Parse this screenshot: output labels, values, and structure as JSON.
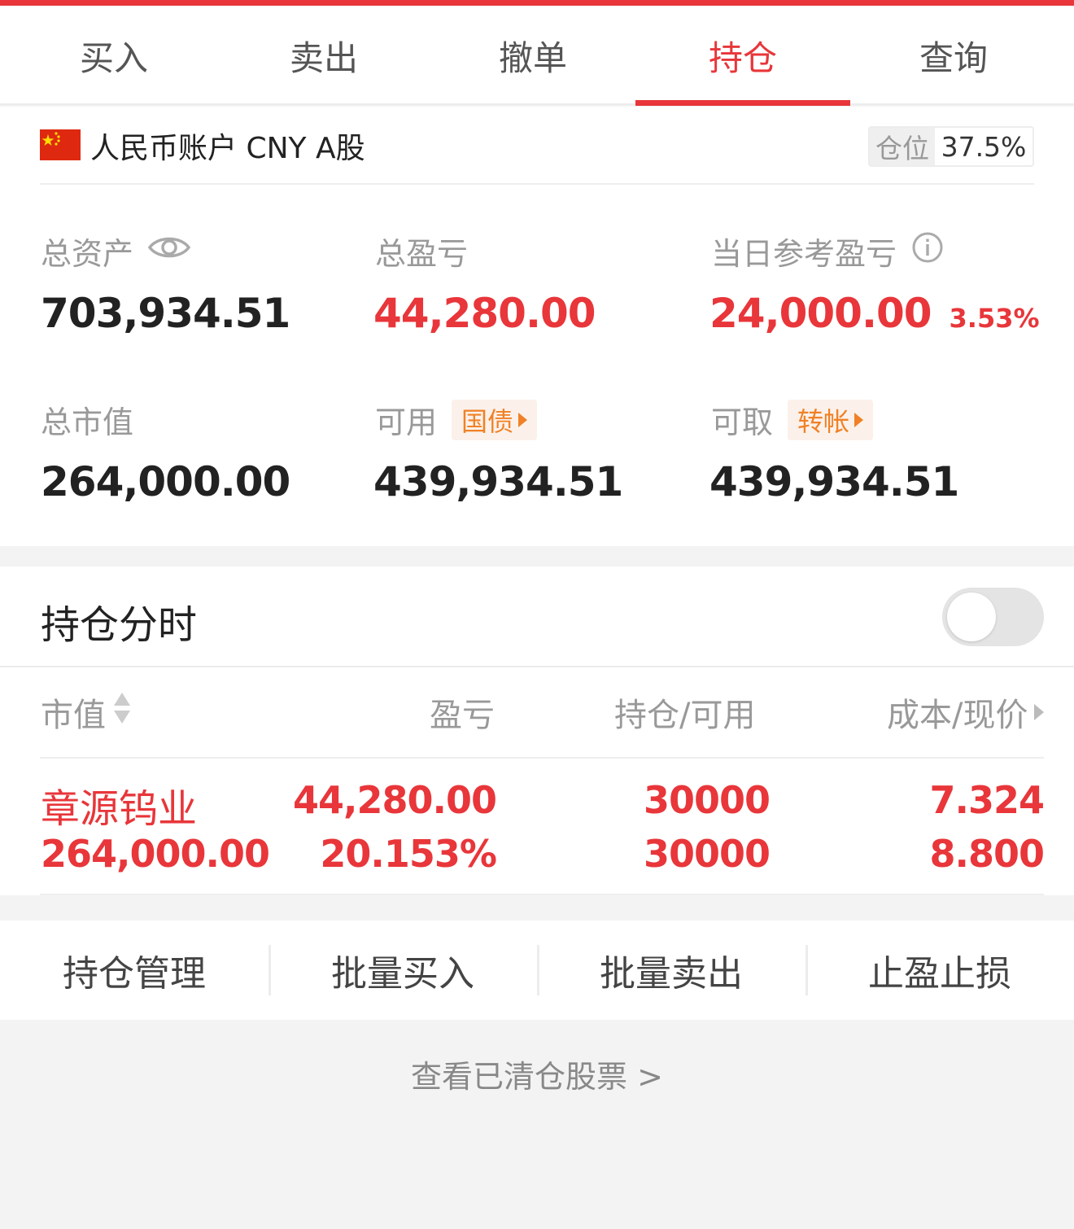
{
  "tabs": [
    {
      "label": "买入"
    },
    {
      "label": "卖出"
    },
    {
      "label": "撤单"
    },
    {
      "label": "持仓"
    },
    {
      "label": "查询"
    }
  ],
  "active_tab": "持仓",
  "account": {
    "flag_icon": "china-flag-icon",
    "name": "人民币账户 CNY A股",
    "position_label": "仓位",
    "position_value": "37.5%"
  },
  "stats": {
    "total_assets": {
      "label": "总资产",
      "value": "703,934.51"
    },
    "total_pnl": {
      "label": "总盈亏",
      "value": "44,280.00"
    },
    "daily_pnl": {
      "label": "当日参考盈亏",
      "value": "24,000.00",
      "pct": "3.53%"
    },
    "market_value": {
      "label": "总市值",
      "value": "264,000.00"
    },
    "available": {
      "label": "可用",
      "tag": "国债",
      "value": "439,934.51"
    },
    "withdrawable": {
      "label": "可取",
      "tag": "转帐",
      "value": "439,934.51"
    }
  },
  "holdings": {
    "title": "持仓分时",
    "toggle_on": false,
    "columns": [
      "市值",
      "盈亏",
      "持仓/可用",
      "成本/现价"
    ],
    "rows": [
      {
        "name": "章源钨业",
        "market_value": "264,000.00",
        "pnl": "44,280.00",
        "pnl_pct": "20.153%",
        "position": "30000",
        "available": "30000",
        "cost": "7.324",
        "price": "8.800"
      }
    ]
  },
  "actions": [
    "持仓管理",
    "批量买入",
    "批量卖出",
    "止盈止损"
  ],
  "cleared_link": "查看已清仓股票 >",
  "colors": {
    "accent": "#e8363a",
    "tag_orange": "#f08126"
  }
}
